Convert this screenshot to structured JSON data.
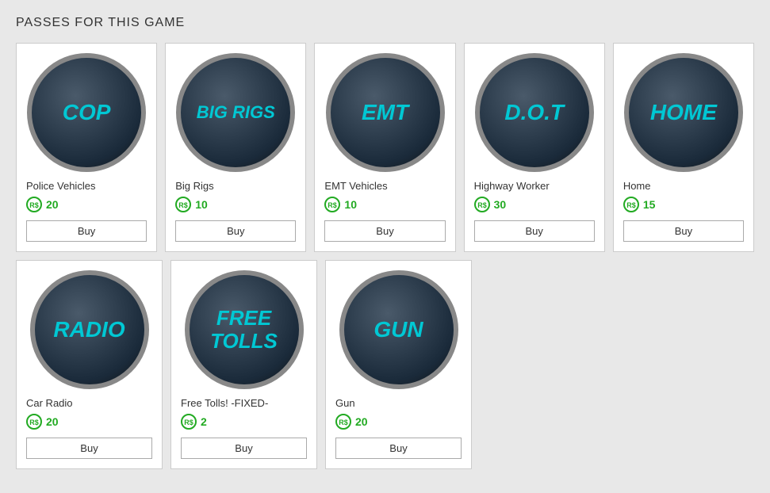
{
  "page": {
    "title": "PASSES FOR THIS GAME"
  },
  "passes": [
    {
      "id": "cop",
      "icon_text": "COP",
      "name": "Police Vehicles",
      "price": 20,
      "buy_label": "Buy"
    },
    {
      "id": "big-rigs",
      "icon_text": "BIG RIGS",
      "name": "Big Rigs",
      "price": 10,
      "buy_label": "Buy"
    },
    {
      "id": "emt",
      "icon_text": "EMT",
      "name": "EMT Vehicles",
      "price": 10,
      "buy_label": "Buy"
    },
    {
      "id": "dot",
      "icon_text": "D.O.T",
      "name": "Highway Worker",
      "price": 30,
      "buy_label": "Buy"
    },
    {
      "id": "home",
      "icon_text": "HOME",
      "name": "Home",
      "price": 15,
      "buy_label": "Buy"
    },
    {
      "id": "radio",
      "icon_text": "RADIO",
      "name": "Car Radio",
      "price": 20,
      "buy_label": "Buy"
    },
    {
      "id": "free-tolls",
      "icon_text": "FREE TOLLS",
      "name": "Free Tolls! -FIXED-",
      "price": 2,
      "buy_label": "Buy"
    },
    {
      "id": "gun",
      "icon_text": "GUN",
      "name": "Gun",
      "price": 20,
      "buy_label": "Buy"
    }
  ],
  "colors": {
    "accent": "#00c8d4",
    "price": "#22aa22"
  }
}
